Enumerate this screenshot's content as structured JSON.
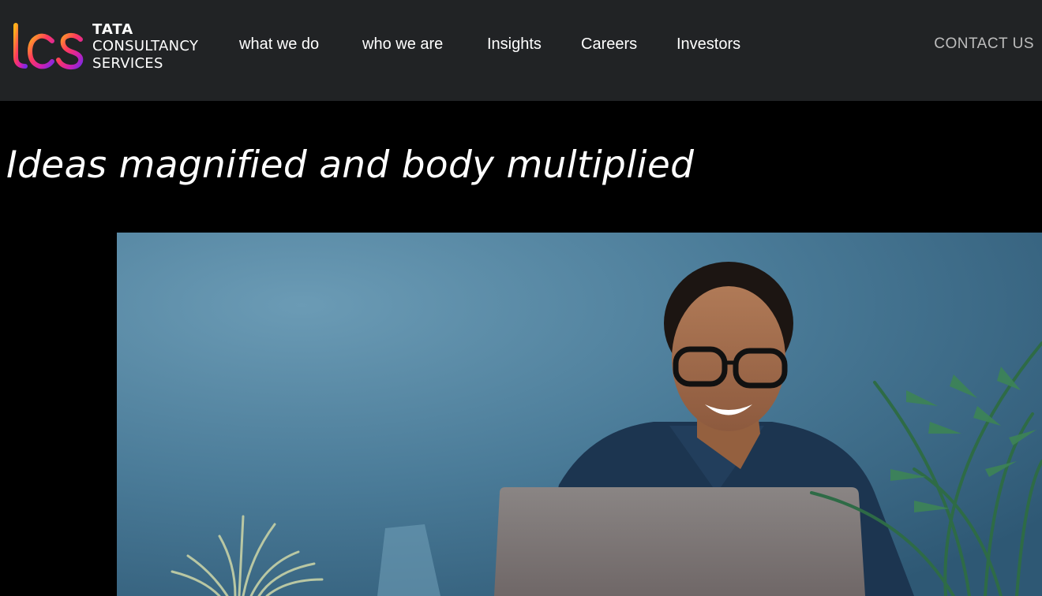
{
  "brand": {
    "mark_text": "tcs",
    "line1": "TATA",
    "line2": "CONSULTANCY",
    "line3": "SERVICES",
    "gradient_colors": [
      "#ff9a1f",
      "#ff2d6b",
      "#c21fb8",
      "#7b2ae0"
    ]
  },
  "nav": {
    "items": [
      {
        "label": "what we do"
      },
      {
        "label": "who we are"
      },
      {
        "label": "Insights"
      },
      {
        "label": "Careers"
      },
      {
        "label": "Investors"
      }
    ],
    "contact_label": "CONTACT US"
  },
  "hero": {
    "headline": "Ideas magnified and body multiplied",
    "image_description_icon": "woman-with-laptop-photo"
  },
  "colors": {
    "header_bg": "#212325",
    "page_bg": "#000000",
    "contact_text": "#bdbdbd",
    "wall_blue": "#3f6f8c"
  }
}
